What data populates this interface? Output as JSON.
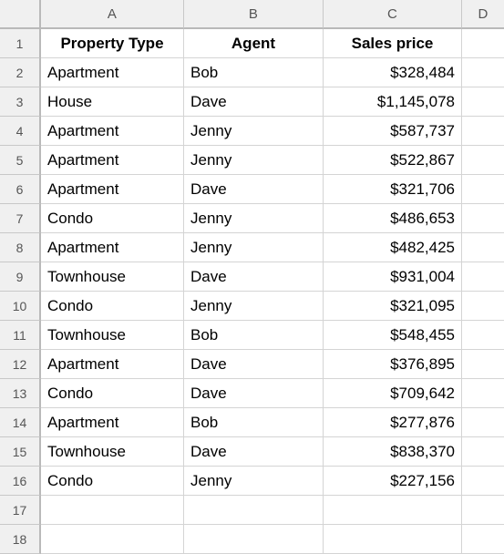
{
  "grid": {
    "corner_label": "",
    "column_letters": [
      "A",
      "B",
      "C",
      "D"
    ],
    "row_numbers": [
      "1",
      "2",
      "3",
      "4",
      "5",
      "6",
      "7",
      "8",
      "9",
      "10",
      "11",
      "12",
      "13",
      "14",
      "15",
      "16",
      "17",
      "18"
    ],
    "colors": {
      "header_background": "#f0f0f0",
      "header_text": "#555555",
      "gridline": "#d4d4d4",
      "header_divider": "#b9b9b9",
      "cell_background": "#ffffff",
      "cell_text": "#000000"
    }
  },
  "table": {
    "headers": [
      "Property Type",
      "Agent",
      "Sales price"
    ],
    "rows": [
      {
        "property_type": "Apartment",
        "agent": "Bob",
        "sales_price": "$328,484"
      },
      {
        "property_type": "House",
        "agent": "Dave",
        "sales_price": "$1,145,078"
      },
      {
        "property_type": "Apartment",
        "agent": "Jenny",
        "sales_price": "$587,737"
      },
      {
        "property_type": "Apartment",
        "agent": "Jenny",
        "sales_price": "$522,867"
      },
      {
        "property_type": "Apartment",
        "agent": "Dave",
        "sales_price": "$321,706"
      },
      {
        "property_type": "Condo",
        "agent": "Jenny",
        "sales_price": "$486,653"
      },
      {
        "property_type": "Apartment",
        "agent": "Jenny",
        "sales_price": "$482,425"
      },
      {
        "property_type": "Townhouse",
        "agent": "Dave",
        "sales_price": "$931,004"
      },
      {
        "property_type": "Condo",
        "agent": "Jenny",
        "sales_price": "$321,095"
      },
      {
        "property_type": "Townhouse",
        "agent": "Bob",
        "sales_price": "$548,455"
      },
      {
        "property_type": "Apartment",
        "agent": "Dave",
        "sales_price": "$376,895"
      },
      {
        "property_type": "Condo",
        "agent": "Dave",
        "sales_price": "$709,642"
      },
      {
        "property_type": "Apartment",
        "agent": "Bob",
        "sales_price": "$277,876"
      },
      {
        "property_type": "Townhouse",
        "agent": "Dave",
        "sales_price": "$838,370"
      },
      {
        "property_type": "Condo",
        "agent": "Jenny",
        "sales_price": "$227,156"
      }
    ],
    "empty_row_labels": [
      "17",
      "18"
    ]
  }
}
